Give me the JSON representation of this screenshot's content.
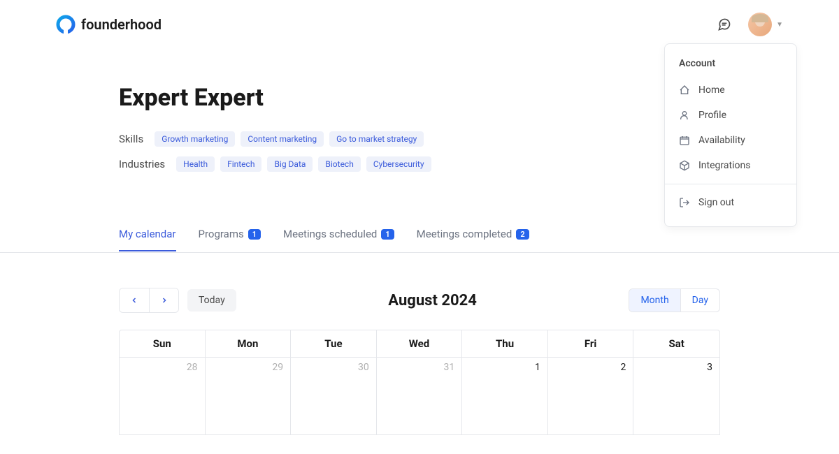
{
  "header": {
    "logo_text": "founderhood"
  },
  "dropdown": {
    "title": "Account",
    "items": [
      {
        "label": "Home",
        "icon": "home"
      },
      {
        "label": "Profile",
        "icon": "user"
      },
      {
        "label": "Availability",
        "icon": "calendar"
      },
      {
        "label": "Integrations",
        "icon": "package"
      }
    ],
    "signout": "Sign out"
  },
  "profile": {
    "name": "Expert Expert",
    "skills_label": "Skills",
    "skills": [
      "Growth marketing",
      "Content marketing",
      "Go to market strategy"
    ],
    "industries_label": "Industries",
    "industries": [
      "Health",
      "Fintech",
      "Big Data",
      "Biotech",
      "Cybersecurity"
    ]
  },
  "tabs": [
    {
      "label": "My calendar",
      "badge": null,
      "active": true
    },
    {
      "label": "Programs",
      "badge": "1",
      "active": false
    },
    {
      "label": "Meetings scheduled",
      "badge": "1",
      "active": false
    },
    {
      "label": "Meetings completed",
      "badge": "2",
      "active": false
    }
  ],
  "calendar": {
    "today_label": "Today",
    "title": "August 2024",
    "view_month": "Month",
    "view_day": "Day",
    "dow": [
      "Sun",
      "Mon",
      "Tue",
      "Wed",
      "Thu",
      "Fri",
      "Sat"
    ],
    "row0": [
      {
        "d": "28",
        "other": true
      },
      {
        "d": "29",
        "other": true
      },
      {
        "d": "30",
        "other": true
      },
      {
        "d": "31",
        "other": true
      },
      {
        "d": "1",
        "other": false
      },
      {
        "d": "2",
        "other": false
      },
      {
        "d": "3",
        "other": false
      }
    ]
  }
}
